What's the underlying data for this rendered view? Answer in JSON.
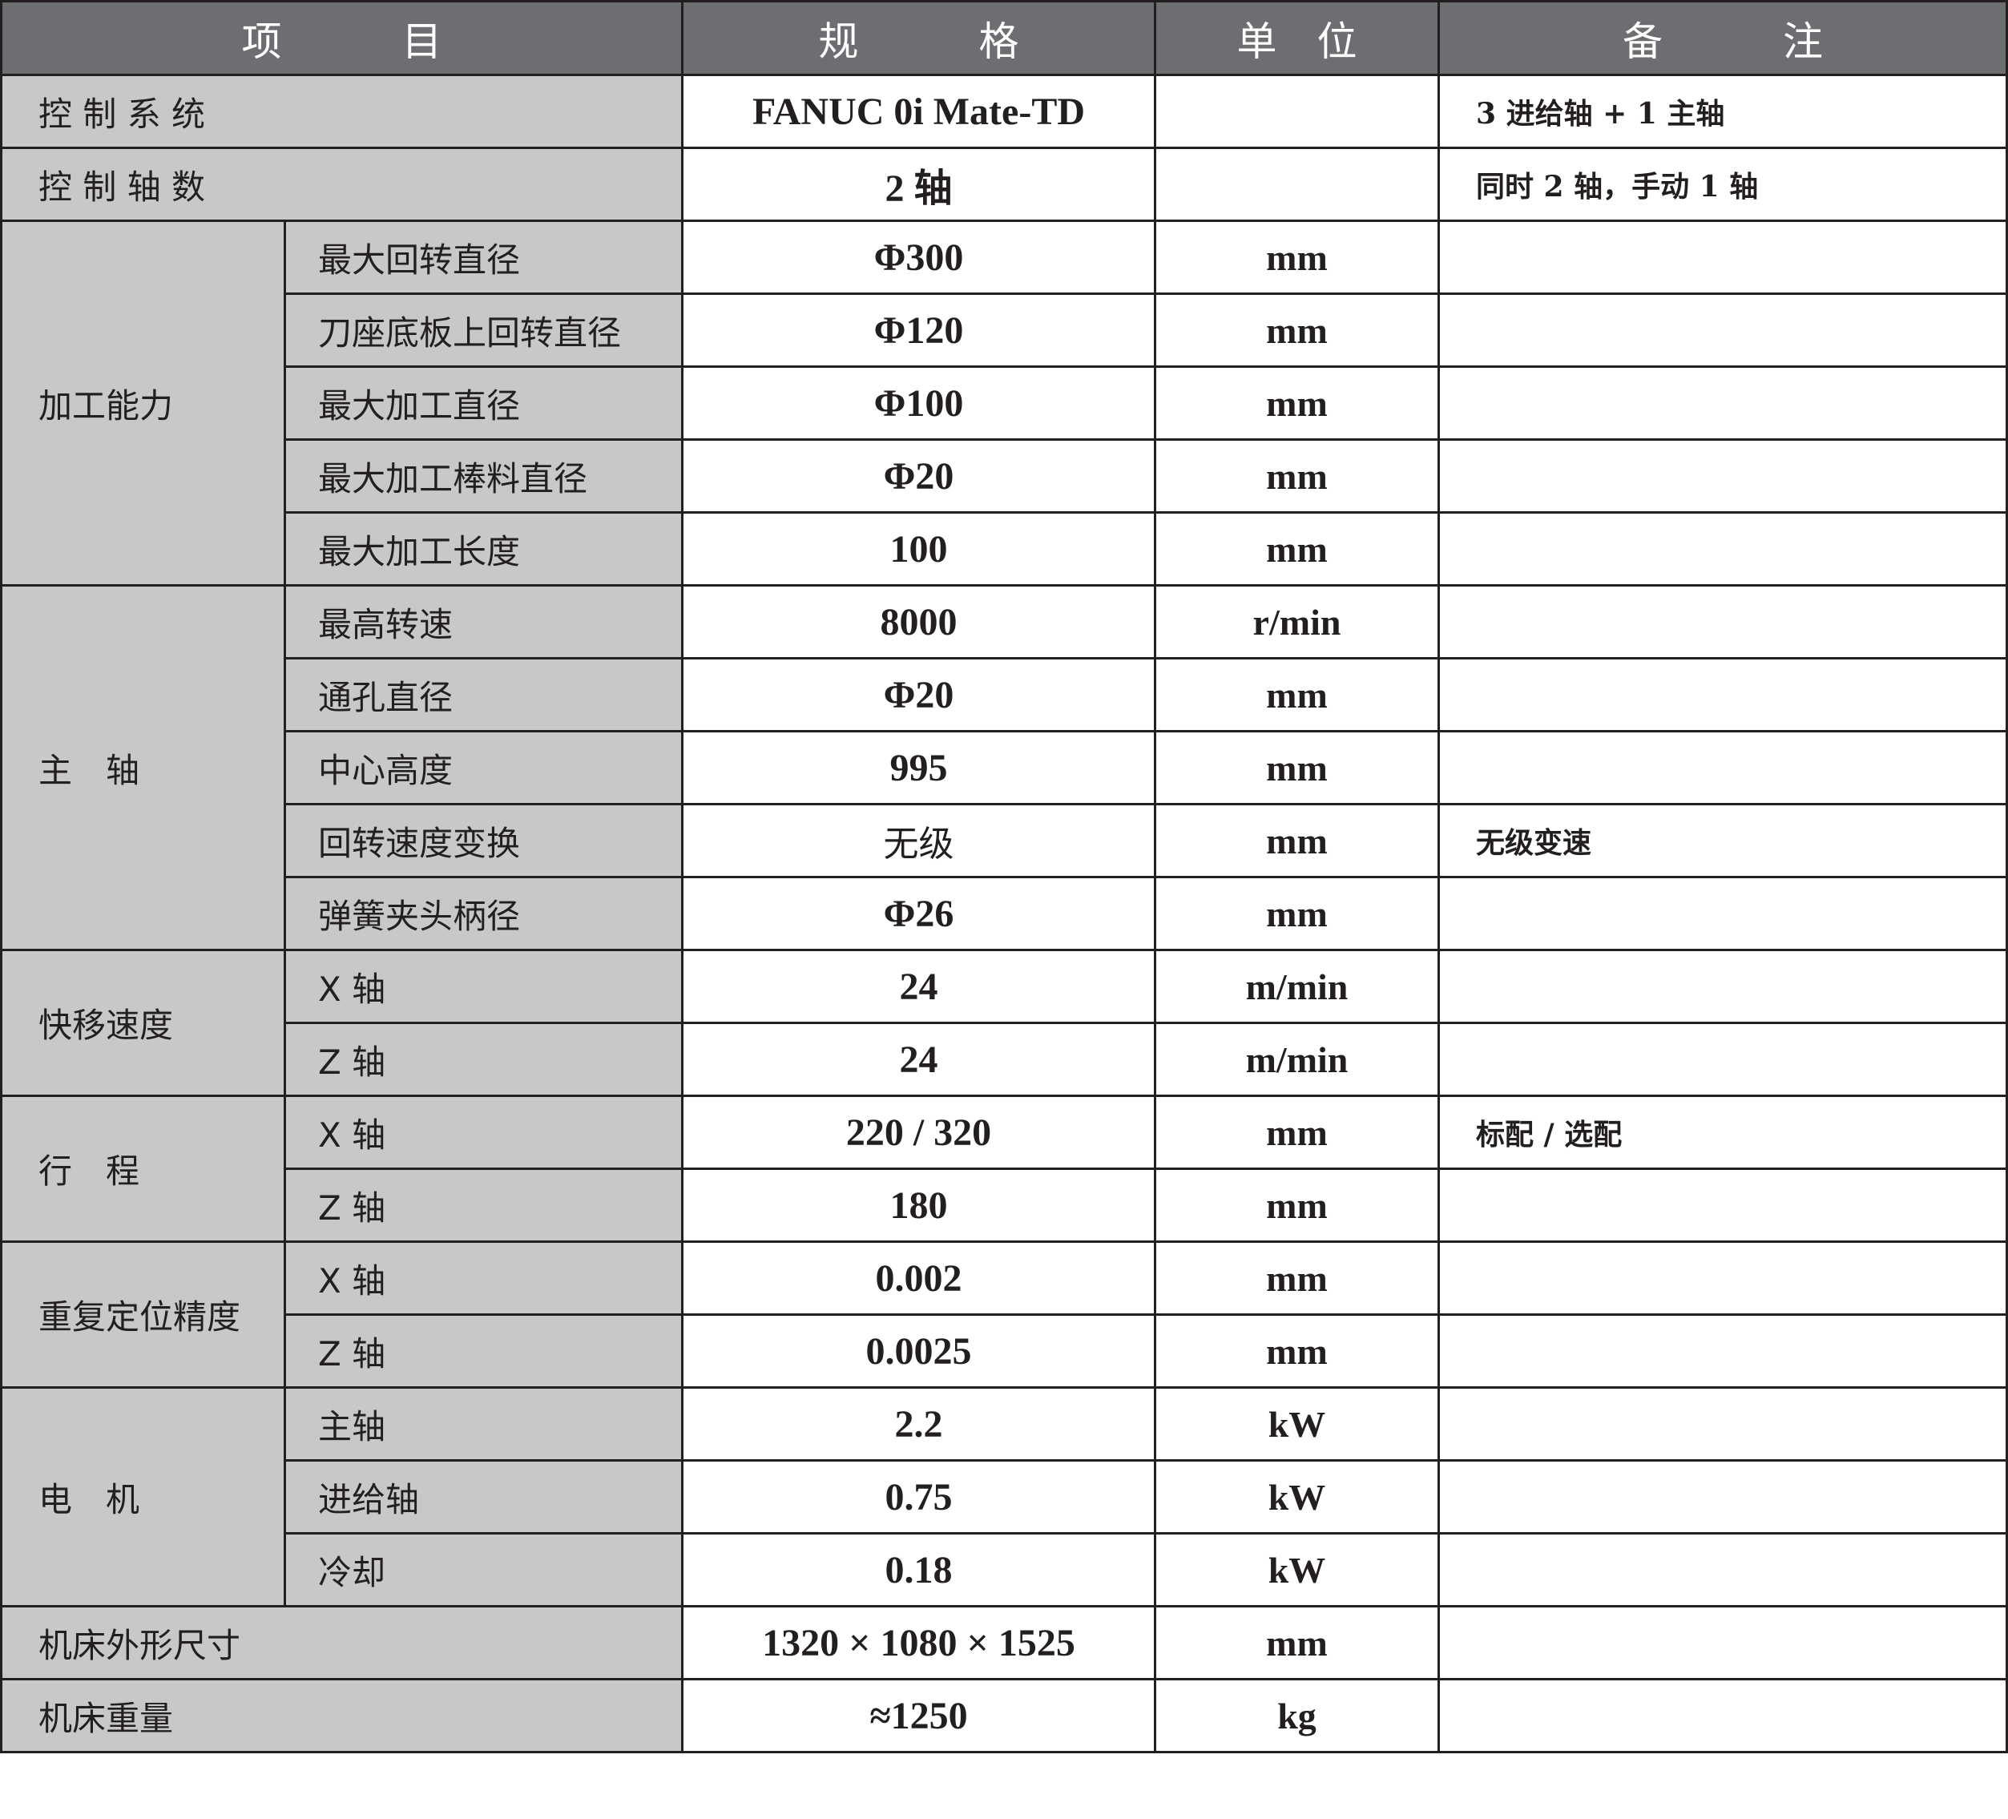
{
  "header": {
    "item": "项　　　目",
    "spec": "规　　　格",
    "unit": "单　位",
    "note": "备　　　注"
  },
  "rows": {
    "control_system": {
      "label": "控 制 系 统",
      "spec": "FANUC 0i Mate-TD",
      "unit": "",
      "note": "3 进给轴 + 1 主轴"
    },
    "control_axes": {
      "label": "控 制 轴 数",
      "spec": "2 轴",
      "unit": "",
      "note": "同时 2 轴，手动 1 轴"
    },
    "machining": {
      "group": "加工能力",
      "items": [
        {
          "label": "最大回转直径",
          "spec": "Φ300",
          "unit": "mm",
          "note": ""
        },
        {
          "label": "刀座底板上回转直径",
          "spec": "Φ120",
          "unit": "mm",
          "note": ""
        },
        {
          "label": "最大加工直径",
          "spec": "Φ100",
          "unit": "mm",
          "note": ""
        },
        {
          "label": "最大加工棒料直径",
          "spec": "Φ20",
          "unit": "mm",
          "note": ""
        },
        {
          "label": "最大加工长度",
          "spec": "100",
          "unit": "mm",
          "note": ""
        }
      ]
    },
    "spindle": {
      "group": "主　轴",
      "items": [
        {
          "label": "最高转速",
          "spec": "8000",
          "unit": "r/min",
          "note": ""
        },
        {
          "label": "通孔直径",
          "spec": "Φ20",
          "unit": "mm",
          "note": ""
        },
        {
          "label": "中心高度",
          "spec": "995",
          "unit": "mm",
          "note": ""
        },
        {
          "label": "回转速度变换",
          "spec": "无级",
          "unit": "mm",
          "note": "无级变速"
        },
        {
          "label": "弹簧夹头柄径",
          "spec": "Φ26",
          "unit": "mm",
          "note": ""
        }
      ]
    },
    "rapid": {
      "group": "快移速度",
      "items": [
        {
          "label": "X 轴",
          "spec": "24",
          "unit": "m/min",
          "note": ""
        },
        {
          "label": "Z 轴",
          "spec": "24",
          "unit": "m/min",
          "note": ""
        }
      ]
    },
    "travel": {
      "group": "行　程",
      "items": [
        {
          "label": "X 轴",
          "spec": "220 / 320",
          "unit": "mm",
          "note": "标配 / 选配"
        },
        {
          "label": "Z 轴",
          "spec": "180",
          "unit": "mm",
          "note": ""
        }
      ]
    },
    "repeat": {
      "group": "重复定位精度",
      "items": [
        {
          "label": "X 轴",
          "spec": "0.002",
          "unit": "mm",
          "note": ""
        },
        {
          "label": "Z 轴",
          "spec": "0.0025",
          "unit": "mm",
          "note": ""
        }
      ]
    },
    "motor": {
      "group": "电　机",
      "items": [
        {
          "label": "主轴",
          "spec": "2.2",
          "unit": "kW",
          "note": ""
        },
        {
          "label": "进给轴",
          "spec": "0.75",
          "unit": "kW",
          "note": ""
        },
        {
          "label": "冷却",
          "spec": "0.18",
          "unit": "kW",
          "note": ""
        }
      ]
    },
    "dimensions": {
      "label": "机床外形尺寸",
      "spec": "1320 × 1080 × 1525",
      "unit": "mm",
      "note": ""
    },
    "weight": {
      "label": "机床重量",
      "spec": "≈1250",
      "unit": "kg",
      "note": ""
    }
  },
  "colors": {
    "header_bg": "#6d6e71",
    "label_bg": "#c8c8c8",
    "border": "#231f20"
  }
}
